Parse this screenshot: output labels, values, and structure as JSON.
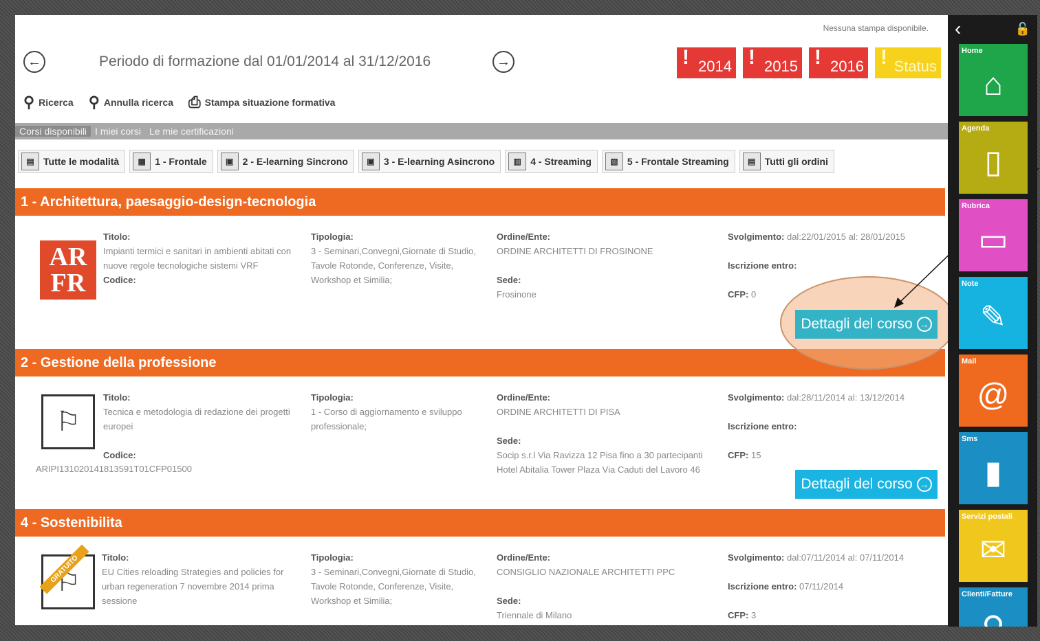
{
  "header": {
    "no_print": "Nessuna stampa disponibile.",
    "period": "Periodo di formazione dal 01/01/2014 al 31/12/2016",
    "prev_icon": "arrow-left-circle",
    "next_icon": "arrow-right-circle",
    "badges": [
      {
        "label": "2014",
        "color": "#e53935"
      },
      {
        "label": "2015",
        "color": "#e53935"
      },
      {
        "label": "2016",
        "color": "#e53935"
      },
      {
        "label": "Status",
        "color": "#f7d21c"
      }
    ]
  },
  "toolbar": {
    "search": "Ricerca",
    "cancel_search": "Annulla ricerca",
    "print": "Stampa situazione formativa"
  },
  "gray_tabs": [
    "Corsi disponibili",
    "I miei corsi",
    "Le mie certificazioni"
  ],
  "mode_tabs": [
    "Tutte le modalità",
    "1 - Frontale",
    "2 - E-learning Sincrono",
    "3 - E-learning Asincrono",
    "4 - Streaming",
    "5 - Frontale Streaming",
    "Tutti gli ordini"
  ],
  "labels": {
    "titolo": "Titolo:",
    "tipologia": "Tipologia:",
    "ordine": "Ordine/Ente:",
    "sede": "Sede:",
    "codice": "Codice:",
    "svolgimento": "Svolgimento:",
    "iscrizione": "Iscrizione entro:",
    "cfp": "CFP:",
    "details_button": "Dettagli del corso"
  },
  "sections": [
    {
      "title": "1 - Architettura, paesaggio-design-tecnologia",
      "logo_text_1": "AR",
      "logo_text_2": "FR",
      "titolo": "Impianti termici e sanitari in ambienti abitati con nuove regole tecnologiche sistemi VRF",
      "codice": "",
      "tipologia": "3 - Seminari,Convegni,Giornate di Studio, Tavole Rotonde, Conferenze, Visite, Workshop et Similia;",
      "ordine": "ORDINE ARCHITETTI DI FROSINONE",
      "sede": "Frosinone",
      "svolgimento": "dal:22/01/2015 al: 28/01/2015",
      "iscrizione": "",
      "cfp": "0"
    },
    {
      "title": "2 - Gestione della professione",
      "titolo": "Tecnica e metodologia di redazione dei progetti europei",
      "codice": "ARIPI131020141813591T01CFP01500",
      "tipologia": "1 - Corso di aggiornamento e sviluppo professionale;",
      "ordine": "ORDINE ARCHITETTI DI PISA",
      "sede": "Socip s.r.l Via Ravizza 12 Pisa fino a 30 partecipanti Hotel Abitalia Tower Plaza Via Caduti del Lavoro 46",
      "svolgimento": "dal:28/11/2014 al: 13/12/2014",
      "iscrizione": "",
      "cfp": "15"
    },
    {
      "title": "4 - Sostenibilita",
      "ribbon": "GRATUITO",
      "titolo": "EU Cities reloading Strategies and policies for urban regeneration 7 novembre 2014 prima sessione",
      "tipologia": "3 - Seminari,Convegni,Giornate di Studio, Tavole Rotonde, Conferenze, Visite, Workshop et Similia;",
      "ordine": "CONSIGLIO NAZIONALE ARCHITETTI PPC",
      "sede": "Triennale di Milano",
      "svolgimento": "dal:07/11/2014 al: 07/11/2014",
      "iscrizione": "07/11/2014",
      "cfp": "3"
    }
  ],
  "sidebar": {
    "tiles": [
      {
        "label": "Home",
        "color": "#1fa64a",
        "icon": "home-icon"
      },
      {
        "label": "Agenda",
        "color": "#b5ab12",
        "icon": "notebook-icon"
      },
      {
        "label": "Rubrica",
        "color": "#e04fc4",
        "icon": "contact-card-icon"
      },
      {
        "label": "Note",
        "color": "#16b3e0",
        "icon": "note-pencil-icon"
      },
      {
        "label": "Mail",
        "color": "#ef6a1e",
        "icon": "at-icon"
      },
      {
        "label": "Sms",
        "color": "#1b8fc4",
        "icon": "phone-icon"
      },
      {
        "label": "Servizi postali",
        "color": "#f0c81d",
        "icon": "envelope-icon"
      },
      {
        "label": "Clienti/Fatture",
        "color": "#1b8fc4",
        "icon": "invoice-icon"
      }
    ]
  }
}
